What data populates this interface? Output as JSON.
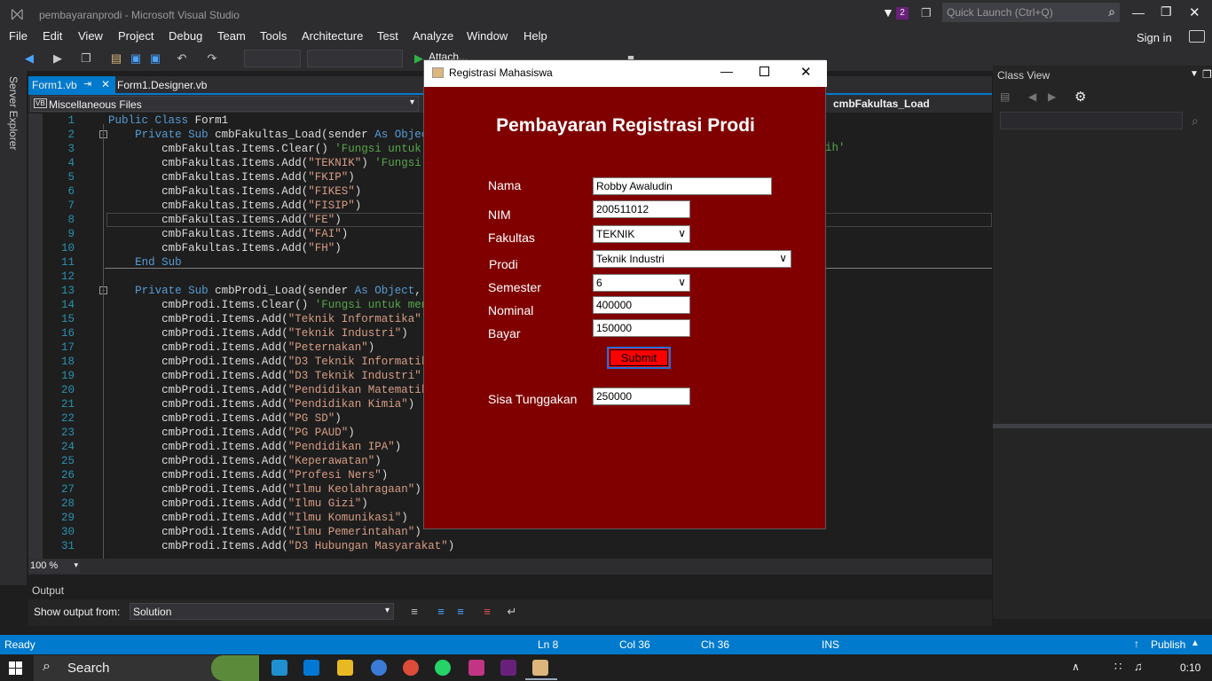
{
  "window": {
    "title": "pembayaranprodi - Microsoft Visual Studio",
    "notification_count": "2",
    "quick_launch_placeholder": "Quick Launch (Ctrl+Q)",
    "sign_in": "Sign in"
  },
  "menu": [
    "File",
    "Edit",
    "View",
    "Project",
    "Debug",
    "Team",
    "Tools",
    "Architecture",
    "Test",
    "Analyze",
    "Window",
    "Help"
  ],
  "toolbar": {
    "attach_label": "Attach..."
  },
  "tabs": [
    {
      "label": "Form1.vb",
      "active": true
    },
    {
      "label": "Form1.Designer.vb",
      "active": false
    }
  ],
  "navbar": {
    "scope": "Miscellaneous Files",
    "member": "cmbFakultas_Load"
  },
  "side_rail": {
    "server_explorer": "Server Explorer"
  },
  "code_lines": [
    {
      "n": "1",
      "t": "Public Class Form1"
    },
    {
      "n": "2",
      "t": "    Private Sub cmbFakultas_Load(sender As Object,"
    },
    {
      "n": "3",
      "t": "        cmbFakultas.Items.Clear() 'Fungsi untuk mer"
    },
    {
      "n": "4",
      "t": "        cmbFakultas.Items.Add(\"TEKNIK\") 'Fungsi unt"
    },
    {
      "n": "5",
      "t": "        cmbFakultas.Items.Add(\"FKIP\")"
    },
    {
      "n": "6",
      "t": "        cmbFakultas.Items.Add(\"FIKES\")"
    },
    {
      "n": "7",
      "t": "        cmbFakultas.Items.Add(\"FISIP\")"
    },
    {
      "n": "8",
      "t": "        cmbFakultas.Items.Add(\"FE\")"
    },
    {
      "n": "9",
      "t": "        cmbFakultas.Items.Add(\"FAI\")"
    },
    {
      "n": "10",
      "t": "        cmbFakultas.Items.Add(\"FH\")"
    },
    {
      "n": "11",
      "t": "    End Sub"
    },
    {
      "n": "12",
      "t": ""
    },
    {
      "n": "13",
      "t": "    Private Sub cmbProdi_Load(sender As Object, e A"
    },
    {
      "n": "14",
      "t": "        cmbProdi.Items.Clear() 'Fungsi untuk mengha"
    },
    {
      "n": "15",
      "t": "        cmbProdi.Items.Add(\"Teknik Informatika\") 'F"
    },
    {
      "n": "16",
      "t": "        cmbProdi.Items.Add(\"Teknik Industri\")"
    },
    {
      "n": "17",
      "t": "        cmbProdi.Items.Add(\"Peternakan\")"
    },
    {
      "n": "18",
      "t": "        cmbProdi.Items.Add(\"D3 Teknik Informatika\")"
    },
    {
      "n": "19",
      "t": "        cmbProdi.Items.Add(\"D3 Teknik Industri\")"
    },
    {
      "n": "20",
      "t": "        cmbProdi.Items.Add(\"Pendidikan Matematika\")"
    },
    {
      "n": "21",
      "t": "        cmbProdi.Items.Add(\"Pendidikan Kimia\")"
    },
    {
      "n": "22",
      "t": "        cmbProdi.Items.Add(\"PG SD\")"
    },
    {
      "n": "23",
      "t": "        cmbProdi.Items.Add(\"PG PAUD\")"
    },
    {
      "n": "24",
      "t": "        cmbProdi.Items.Add(\"Pendidikan IPA\")"
    },
    {
      "n": "25",
      "t": "        cmbProdi.Items.Add(\"Keperawatan\")"
    },
    {
      "n": "26",
      "t": "        cmbProdi.Items.Add(\"Profesi Ners\")"
    },
    {
      "n": "27",
      "t": "        cmbProdi.Items.Add(\"Ilmu Keolahragaan\")"
    },
    {
      "n": "28",
      "t": "        cmbProdi.Items.Add(\"Ilmu Gizi\")"
    },
    {
      "n": "29",
      "t": "        cmbProdi.Items.Add(\"Ilmu Komunikasi\")"
    },
    {
      "n": "30",
      "t": "        cmbProdi.Items.Add(\"Ilmu Pemerintahan\")"
    },
    {
      "n": "31",
      "t": "        cmbProdi.Items.Add(\"D3 Hubungan Masyarakat\")"
    }
  ],
  "code_tail": "ih'",
  "zoom": "100 %",
  "class_view": {
    "title": "Class View"
  },
  "output": {
    "title": "Output",
    "show_from_label": "Show output from:",
    "source": "Solution"
  },
  "status": {
    "ready": "Ready",
    "ln": "Ln 8",
    "col": "Col 36",
    "ch": "Ch 36",
    "ins": "INS",
    "publish": "Publish"
  },
  "taskbar": {
    "search": "Search",
    "time": "0:10"
  },
  "dialog": {
    "title": "Registrasi Mahasiswa",
    "heading": "Pembayaran Registrasi Prodi",
    "nama_label": "Nama",
    "nama_value": "Robby Awaludin",
    "nim_label": "NIM",
    "nim_value": "200511012",
    "fakultas_label": "Fakultas",
    "fakultas_value": "TEKNIK",
    "prodi_label": "Prodi",
    "prodi_value": "Teknik Industri",
    "semester_label": "Semester",
    "semester_value": "6",
    "nominal_label": "Nominal",
    "nominal_value": "400000",
    "bayar_label": "Bayar",
    "bayar_value": "150000",
    "submit_label": "Submit",
    "sisa_label": "Sisa Tunggakan",
    "sisa_value": "250000"
  },
  "colors": {
    "accent": "#007acc",
    "form_bg": "#800000",
    "submit_bg": "#ff0000"
  }
}
